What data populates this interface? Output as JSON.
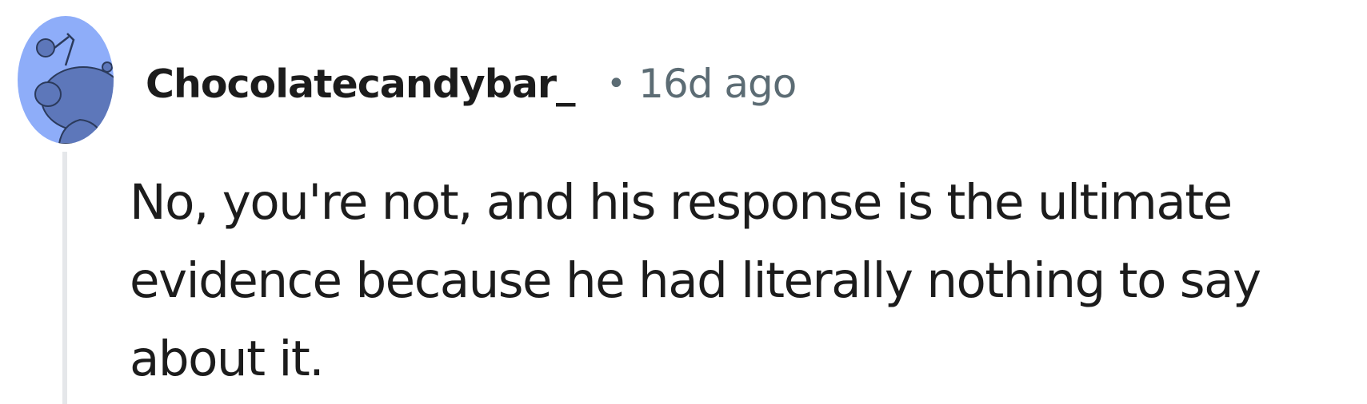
{
  "comment": {
    "username": "Chocolatecandybar_",
    "separator": "•",
    "timestamp": "16d ago",
    "body": "No, you're not, and his response is the ultimate evidence because he had literally nothing to say about it.",
    "avatar_icon": "reddit-snoo-avatar-icon"
  },
  "colors": {
    "avatar_bg": "#8eadf9",
    "avatar_figure": "#5d77ba",
    "username": "#1c1c1c",
    "meta": "#5c6c74",
    "body": "#1c1c1c",
    "thread_line": "#e5e7ea"
  }
}
